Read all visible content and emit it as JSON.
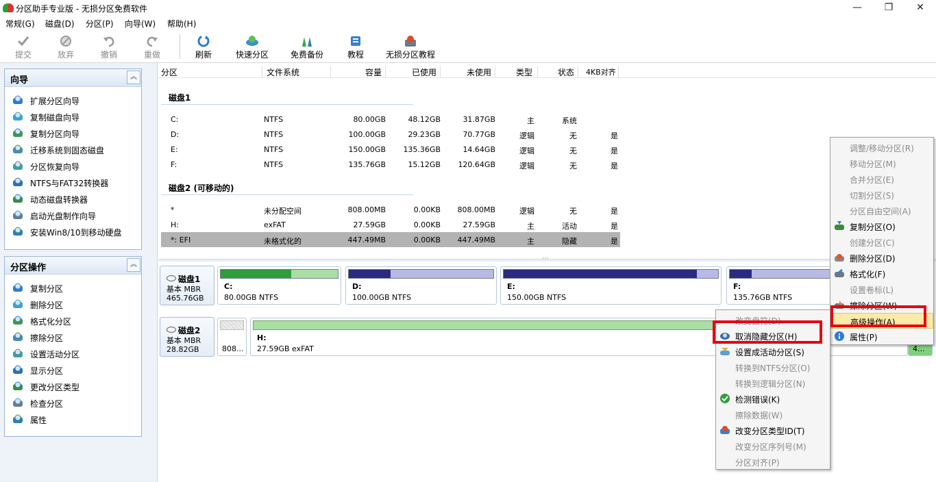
{
  "window": {
    "title": "分区助手专业版 - 无损分区免费软件",
    "minimize_glyph": "—",
    "maximize_glyph": "❐",
    "close_glyph": "✕"
  },
  "menu": [
    "常规(G)",
    "磁盘(D)",
    "分区(P)",
    "向导(W)",
    "帮助(H)"
  ],
  "toolbar": [
    {
      "label": "提交",
      "icon": "check-icon",
      "enabled": false
    },
    {
      "label": "放弃",
      "icon": "discard-icon",
      "enabled": false
    },
    {
      "label": "撤销",
      "icon": "undo-icon",
      "enabled": false
    },
    {
      "label": "重做",
      "icon": "redo-icon",
      "enabled": false
    },
    {
      "label": "刷新",
      "icon": "refresh-icon",
      "enabled": true
    },
    {
      "label": "快速分区",
      "icon": "quick-partition-icon",
      "enabled": true
    },
    {
      "label": "免费备份",
      "icon": "backup-icon",
      "enabled": true
    },
    {
      "label": "教程",
      "icon": "tutorial-icon",
      "enabled": true
    },
    {
      "label": "无损分区教程",
      "icon": "lossless-tutorial-icon",
      "enabled": true
    }
  ],
  "wizard_panel": {
    "title": "向导",
    "collapse_glyph": "︽",
    "items": [
      "扩展分区向导",
      "复制磁盘向导",
      "复制分区向导",
      "迁移系统到固态磁盘",
      "分区恢复向导",
      "NTFS与FAT32转换器",
      "动态磁盘转换器",
      "启动光盘制作向导",
      "安装Win8/10到移动硬盘"
    ]
  },
  "ops_panel": {
    "title": "分区操作",
    "collapse_glyph": "︽",
    "items": [
      "复制分区",
      "删除分区",
      "格式化分区",
      "擦除分区",
      "设置活动分区",
      "显示分区",
      "更改分区类型",
      "检查分区",
      "属性"
    ]
  },
  "table": {
    "headers": [
      "分区",
      "文件系统",
      "容量",
      "已使用",
      "未使用",
      "类型",
      "状态",
      "4KB对齐"
    ],
    "disk1": {
      "title": "磁盘1",
      "rows": [
        [
          "C:",
          "NTFS",
          "80.00GB",
          "48.12GB",
          "31.87GB",
          "主",
          "系统",
          ""
        ],
        [
          "D:",
          "NTFS",
          "100.00GB",
          "29.23GB",
          "70.77GB",
          "逻辑",
          "无",
          "是"
        ],
        [
          "E:",
          "NTFS",
          "150.00GB",
          "135.36GB",
          "14.64GB",
          "逻辑",
          "无",
          "是"
        ],
        [
          "F:",
          "NTFS",
          "135.76GB",
          "15.12GB",
          "120.64GB",
          "逻辑",
          "无",
          "是"
        ]
      ]
    },
    "disk2": {
      "title": "磁盘2 (可移动的)",
      "rows": [
        [
          "*",
          "未分配空间",
          "808.00MB",
          "0.00KB",
          "808.00MB",
          "逻辑",
          "无",
          "是"
        ],
        [
          "H:",
          "exFAT",
          "27.59GB",
          "0.00KB",
          "27.59GB",
          "主",
          "活动",
          "是"
        ],
        [
          "*: EFI",
          "未格式化的",
          "447.49MB",
          "0.00KB",
          "447.49MB",
          "主",
          "隐藏",
          "是"
        ]
      ]
    }
  },
  "disk_map": {
    "splitter_glyph": "⋯",
    "disk1": {
      "name": "磁盘1",
      "type": "基本 MBR",
      "size": "465.76GB",
      "partitions": [
        {
          "label": "C:",
          "info": "80.00GB NTFS",
          "used": 0.6
        },
        {
          "label": "D:",
          "info": "100.00GB NTFS",
          "used": 0.29
        },
        {
          "label": "E:",
          "info": "150.00GB NTFS",
          "used": 0.9
        },
        {
          "label": "F:",
          "info": "135.76GB NTFS",
          "used": 0.11
        }
      ]
    },
    "disk2": {
      "name": "磁盘2",
      "type": "基本 MBR",
      "size": "28.82GB",
      "partitions": [
        {
          "label": "",
          "info": "808...",
          "used": 0
        },
        {
          "label": "H:",
          "info": "27.59GB exFAT",
          "used": 0
        },
        {
          "label": "",
          "info": "4...",
          "used": 0
        }
      ]
    }
  },
  "context_menu_main": [
    {
      "label": "调整/移动分区(R)",
      "enabled": false,
      "icon": ""
    },
    {
      "label": "移动分区(M)",
      "enabled": false,
      "icon": ""
    },
    {
      "label": "合并分区(E)",
      "enabled": false,
      "icon": ""
    },
    {
      "label": "切割分区(S)",
      "enabled": false,
      "icon": ""
    },
    {
      "label": "分区自由空间(A)",
      "enabled": false,
      "icon": ""
    },
    {
      "label": "复制分区(O)",
      "enabled": true,
      "icon": "copy-partition-icon"
    },
    {
      "label": "创建分区(C)",
      "enabled": false,
      "icon": ""
    },
    {
      "label": "删除分区(D)",
      "enabled": true,
      "icon": "delete-partition-icon"
    },
    {
      "label": "格式化(F)",
      "enabled": true,
      "icon": "format-icon"
    },
    {
      "label": "设置卷标(L)",
      "enabled": false,
      "icon": ""
    },
    {
      "label": "擦除分区(W)",
      "enabled": true,
      "icon": "wipe-icon"
    },
    {
      "label": "高级操作(A)",
      "enabled": true,
      "icon": "",
      "highlighted": true
    },
    {
      "label": "属性(P)",
      "enabled": true,
      "icon": "info-icon"
    }
  ],
  "context_menu_sub": [
    {
      "label": "改变盘符(D)",
      "enabled": false,
      "icon": ""
    },
    {
      "label": "取消隐藏分区(H)",
      "enabled": true,
      "icon": "unhide-icon"
    },
    {
      "label": "设置成活动分区(S)",
      "enabled": true,
      "icon": "set-active-icon"
    },
    {
      "label": "转换到NTFS分区(O)",
      "enabled": false,
      "icon": ""
    },
    {
      "label": "转换到逻辑分区(N)",
      "enabled": false,
      "icon": ""
    },
    {
      "label": "检测错误(K)",
      "enabled": true,
      "icon": "check-error-icon"
    },
    {
      "label": "擦除数据(W)",
      "enabled": false,
      "icon": ""
    },
    {
      "label": "改变分区类型ID(T)",
      "enabled": true,
      "icon": "change-type-id-icon"
    },
    {
      "label": "改变分区序列号(M)",
      "enabled": false,
      "icon": ""
    },
    {
      "label": "分区对齐(P)",
      "enabled": false,
      "icon": ""
    }
  ],
  "colors": {
    "bar_used_green": "#2f9e3a",
    "bar_free_green": "#a9dfa5",
    "bar_used_blue": "#2a2a7e",
    "bar_free_blue": "#b9b9e6",
    "highlight_box": "#e60012",
    "menu_highlight": "#fbeaa8"
  }
}
